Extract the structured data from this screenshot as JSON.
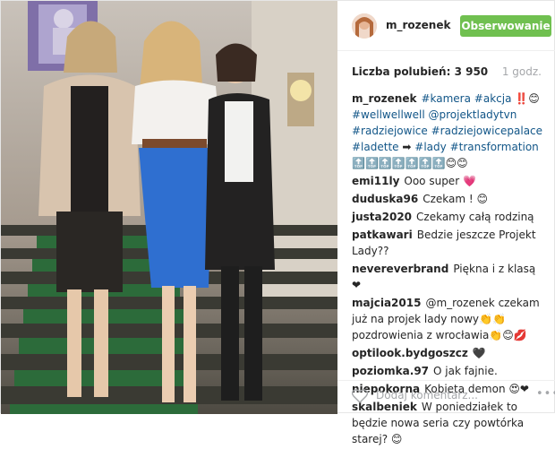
{
  "post": {
    "username": "m_rozenek",
    "follow_label": "Obserwowanie",
    "likes_label": "Liczba polubień: 3 950",
    "time": "1 godz.",
    "caption": {
      "author": "m_rozenek",
      "line1": [
        "#kamera",
        "#akcja",
        "‼️😊"
      ],
      "line2": [
        "#wellwellwell",
        "@projektladytvn"
      ],
      "line3": [
        "#radziejowice",
        "#radziejowicepalace"
      ],
      "line4": [
        "#ladette",
        "➡",
        "#lady",
        "#transformation",
        "🔝🔝🔝🔝🔝🔝🔝😊😊"
      ]
    },
    "comments": [
      {
        "author": "emi11ly",
        "text": "Ooo super 💗"
      },
      {
        "author": "duduska96",
        "text": "Czekam ! 😊"
      },
      {
        "author": "justa2020",
        "text": "Czekamy całą rodziną"
      },
      {
        "author": "patkawari",
        "text": "Bedzie jeszcze Projekt Lady??"
      },
      {
        "author": "nevereverbrand",
        "text": "Piękna i z klasą❤"
      },
      {
        "author": "majcia2015",
        "text": "@m_rozenek czekam już na projek lady nowy👏👏pozdrowienia z wrocławia👏😊💋"
      },
      {
        "author": "optilook.bydgoszcz",
        "text": "🖤"
      },
      {
        "author": "poziomka.97",
        "text": "O jak fajnie."
      },
      {
        "author": "niepokorna",
        "text": "Kobieta demon 😍❤"
      },
      {
        "author": "skalbeniek",
        "text": "W poniedziałek to będzie nowa seria czy powtórka starej? 😊"
      }
    ],
    "add_comment_placeholder": "Dodaj komentarz...",
    "more_label": "•••"
  }
}
